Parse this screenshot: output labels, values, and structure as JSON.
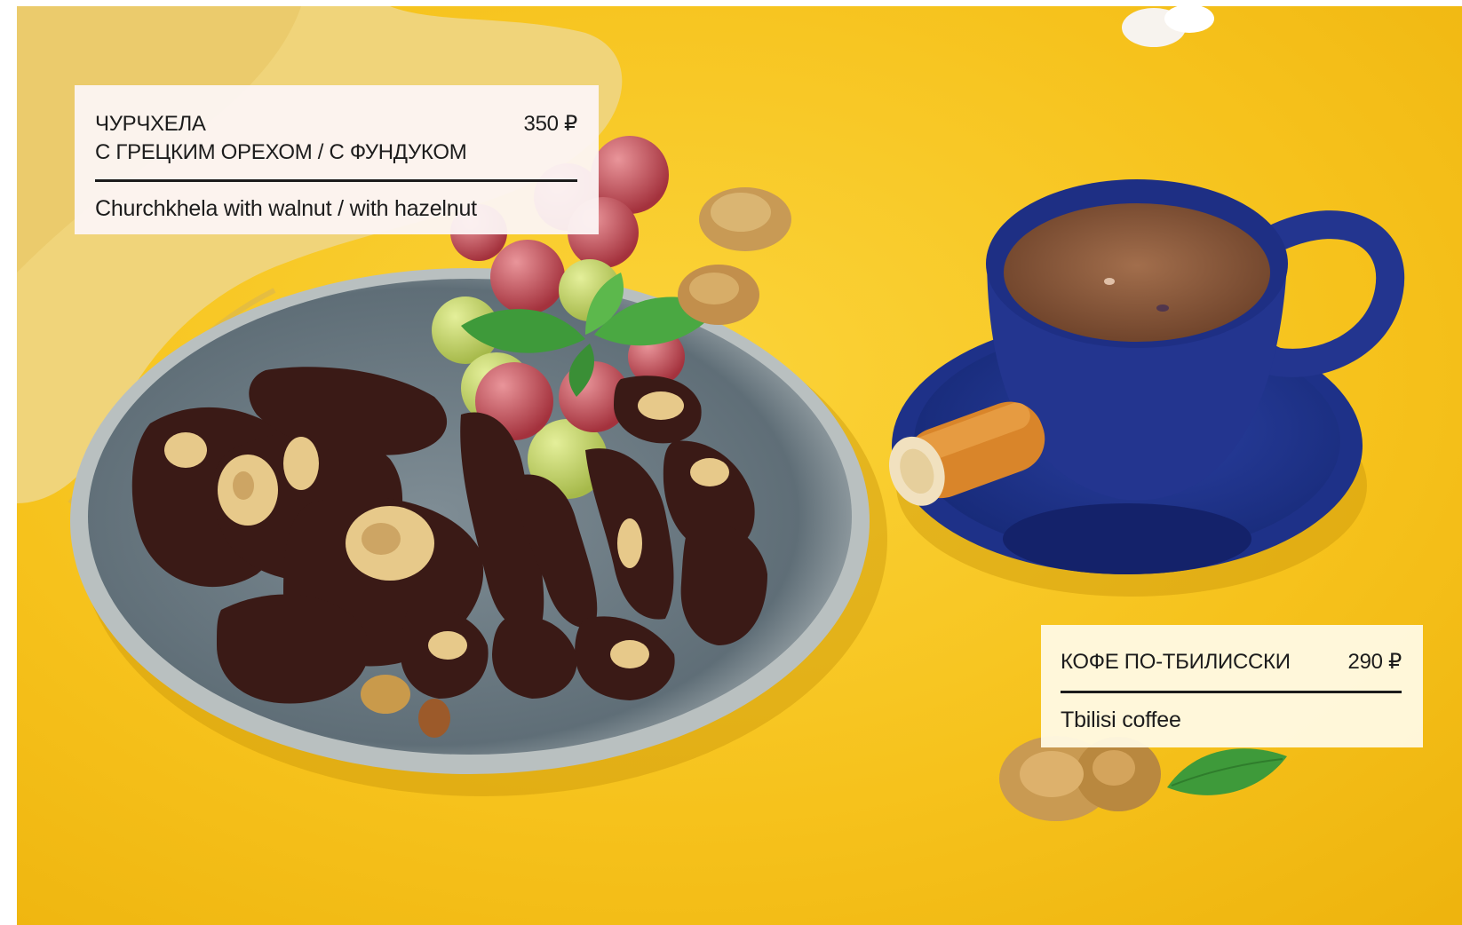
{
  "items": [
    {
      "title_ru_line1": "ЧУРЧХЕЛА",
      "title_ru_line2": "С ГРЕЦКИМ ОРЕХОМ / С ФУНДУКОМ",
      "price": "350 ₽",
      "title_en": "Churchkhela with walnut / with hazelnut"
    },
    {
      "title_ru_line1": "КОФЕ ПО-ТБИЛИССКИ",
      "price": "290 ₽",
      "title_en": "Tbilisi coffee"
    }
  ],
  "colors": {
    "background_yellow": "#f6c21c",
    "plate": "#6f7f88",
    "cup_blue": "#23358f",
    "coffee": "#8a5a3c",
    "chocolate": "#3a1a16",
    "grape_red": "#b9424a",
    "grape_green": "#b8c95a",
    "mint": "#3e9a3a",
    "napkin": "#f0d47a"
  }
}
